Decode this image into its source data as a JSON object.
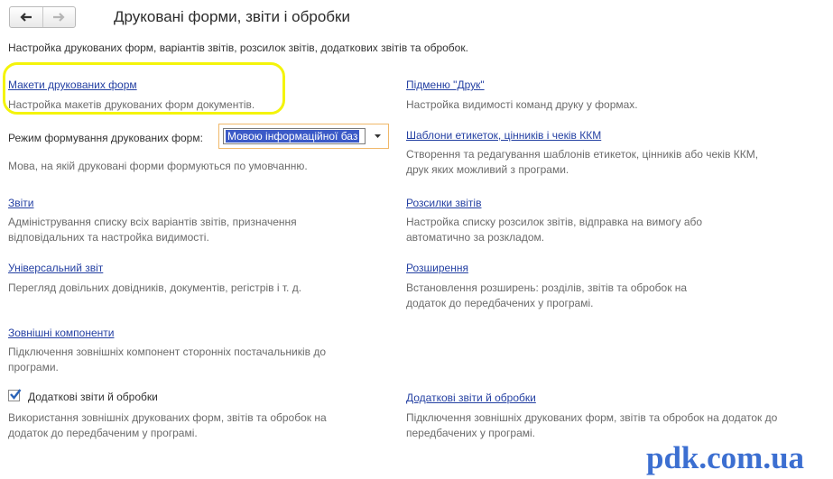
{
  "header": {
    "title": "Друковані форми, звіти і обробки",
    "subtitle": "Настройка друкованих форм, варіантів звітів, розсилок звітів, додаткових звітів та обробок."
  },
  "left": {
    "makety": {
      "link": "Макети друкованих форм",
      "desc": "Настройка макетів друкованих форм документів."
    },
    "mode": {
      "label": "Режим формування друкованих форм:",
      "value": "Мовою інформаційної баз",
      "desc": "Мова, на якій друковані форми формуються по умовчанню."
    },
    "zvity": {
      "link": "Звіти",
      "desc": "Адміністрування списку всіх варіантів звітів, призначення відповідальних та настройка видимості."
    },
    "universal": {
      "link": "Універсальний звіт",
      "desc": "Перегляд довільних довідників, документів, регістрів і т. д."
    },
    "external": {
      "link": "Зовнішні компоненти",
      "desc": "Підключення зовнішніх компонент сторонніх постачальників до програми."
    },
    "additional_check": {
      "label": "Додаткові звіти й обробки",
      "checked": true,
      "desc": "Використання зовнішніх друкованих форм, звітів та обробок на додаток до передбаченим у програмі."
    }
  },
  "right": {
    "submenu": {
      "link": "Підменю \"Друк\"",
      "desc": "Настройка видимості команд друку у формах."
    },
    "templates": {
      "link": "Шаблони етикеток, цінників і чеків ККМ",
      "desc": "Створення та редагування шаблонів етикеток, цінників або чеків ККМ, друк яких можливий з програми."
    },
    "mailings": {
      "link": "Розсилки звітів",
      "desc": "Настройка списку розсилок звітів, відправка на вимогу або автоматично за розкладом."
    },
    "extensions": {
      "link": "Розширення",
      "desc": "Встановлення розширень: розділів, звітів та обробок на додаток до передбачених у програмі."
    },
    "additional_link": {
      "link": "Додаткові звіти й обробки",
      "desc": "Підключення зовнішніх друкованих форм, звітів та обробок на додаток до передбачених у програмі."
    }
  },
  "watermark": "pdk.com.ua",
  "colors": {
    "link": "#2541a3",
    "description": "#6b6b6b",
    "highlight": "#f4f40a",
    "select_border": "#f0b86a",
    "selected_bg": "#3b5ac7",
    "watermark": "#3c6fd1"
  },
  "icons": [
    "back-arrow-icon",
    "forward-arrow-icon",
    "dropdown-arrow-icon",
    "checkmark-icon"
  ]
}
